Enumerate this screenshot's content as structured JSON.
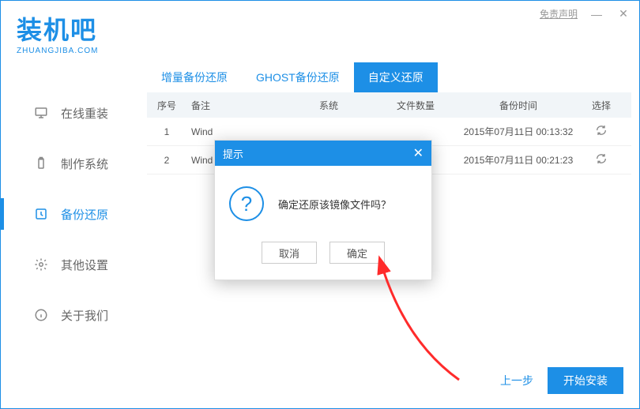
{
  "titlebar": {
    "disclaimer": "免责声明",
    "logo_main": "装机吧",
    "logo_sub": "ZHUANGJIBA.COM"
  },
  "sidebar": {
    "items": [
      {
        "label": "在线重装"
      },
      {
        "label": "制作系统"
      },
      {
        "label": "备份还原"
      },
      {
        "label": "其他设置"
      },
      {
        "label": "关于我们"
      }
    ]
  },
  "tabs": {
    "items": [
      {
        "label": "增量备份还原"
      },
      {
        "label": "GHOST备份还原"
      },
      {
        "label": "自定义还原"
      }
    ]
  },
  "table": {
    "headers": {
      "idx": "序号",
      "note": "备注",
      "sys": "系统",
      "cnt": "文件数量",
      "time": "备份时间",
      "sel": "选择"
    },
    "rows": [
      {
        "idx": "1",
        "note": "Wind",
        "time": "2015年07月11日 00:13:32"
      },
      {
        "idx": "2",
        "note": "Wind",
        "time": "2015年07月11日 00:21:23"
      }
    ]
  },
  "dialog": {
    "title": "提示",
    "message": "确定还原该镜像文件吗？",
    "cancel": "取消",
    "ok": "确定"
  },
  "footer": {
    "prev": "上一步",
    "install": "开始安装"
  }
}
